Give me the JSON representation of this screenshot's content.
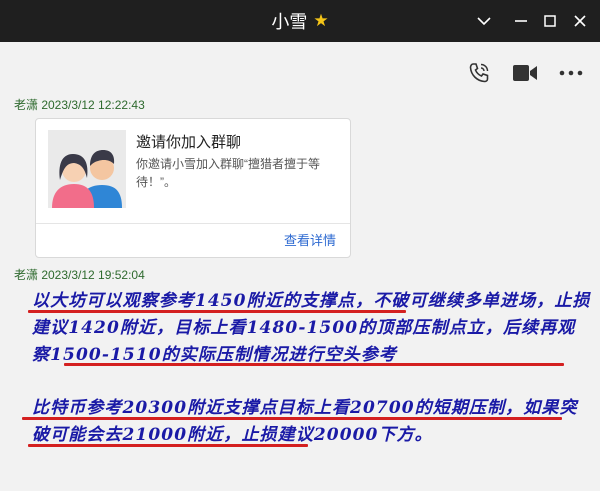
{
  "window": {
    "title": "小雪",
    "title_icon": "star-icon",
    "controls": [
      "chevron-down-icon",
      "minimize-icon",
      "maximize-icon",
      "close-icon"
    ]
  },
  "toolbar": {
    "icons": [
      "phone-call-icon",
      "video-call-icon",
      "more-icon"
    ]
  },
  "messages": [
    {
      "sender": "老潇 2023/3/12 12:22:43",
      "card": {
        "title": "邀请你加入群聊",
        "description": "你邀请小雪加入群聊“擅猎者擅于等待！”。",
        "link": "查看详情"
      }
    },
    {
      "sender": "老潇 2023/3/12 19:52:04",
      "paragraphs": [
        "以大坊可以观察参考1450附近的支撑点，不破可继续多单进场，止损建议1420附近，目标上看1480-1500的顶部压制点立，后续再观察1500-1510的实际压制情况进行空头参考",
        "比特币参考20300附近支撑点目标上看20700的短期压制，如果突破可能会去21000附近，止损建议20000下方。"
      ]
    }
  ],
  "colors": {
    "titlebar": "#1f1f1f",
    "background": "#f2f2f2",
    "message_text": "#1a1aa6",
    "underline": "#d42020",
    "link": "#2e6ad1",
    "sender": "#2e6a2e"
  }
}
